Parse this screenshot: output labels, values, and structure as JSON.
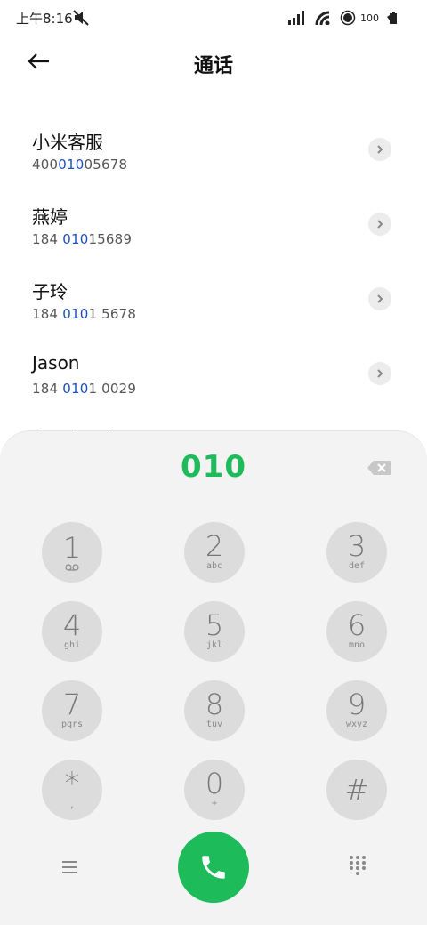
{
  "status_bar": {
    "time": "上午8:16",
    "battery": "100",
    "icons": [
      "mute-icon",
      "signal-icon",
      "wifi-icon",
      "circle-icon",
      "battery-icon"
    ]
  },
  "header": {
    "title": "通话",
    "back_icon": "arrow-left-icon"
  },
  "contacts": [
    {
      "name": "小米客服",
      "number_pre": "400",
      "number_hl": "010",
      "number_post": "05678"
    },
    {
      "name": "燕婷",
      "number_pre": "184 ",
      "number_hl": "010",
      "number_post": "15689"
    },
    {
      "name": "子玲",
      "number_pre": "184 ",
      "number_hl": "010",
      "number_post": "1 5678"
    },
    {
      "name": "Jason",
      "number_pre": "184 ",
      "number_hl": "010",
      "number_post": "1 0029"
    },
    {
      "name": "Stephanie",
      "number_pre": "",
      "number_hl": "",
      "number_post": ""
    }
  ],
  "dialer": {
    "input": "010",
    "keys": [
      {
        "digit": "1",
        "letters": "voicemail-icon"
      },
      {
        "digit": "2",
        "letters": "abc"
      },
      {
        "digit": "3",
        "letters": "def"
      },
      {
        "digit": "4",
        "letters": "ghi"
      },
      {
        "digit": "5",
        "letters": "jkl"
      },
      {
        "digit": "6",
        "letters": "mno"
      },
      {
        "digit": "7",
        "letters": "pqrs"
      },
      {
        "digit": "8",
        "letters": "tuv"
      },
      {
        "digit": "9",
        "letters": "wxyz"
      },
      {
        "digit": "*",
        "letters": ","
      },
      {
        "digit": "0",
        "letters": "+"
      },
      {
        "digit": "#",
        "letters": ""
      }
    ]
  },
  "colors": {
    "accent_green": "#1dbb5a",
    "highlight_blue": "#1a4fbf",
    "panel_bg": "#f3f3f3",
    "key_bg": "#dcdcdc"
  }
}
